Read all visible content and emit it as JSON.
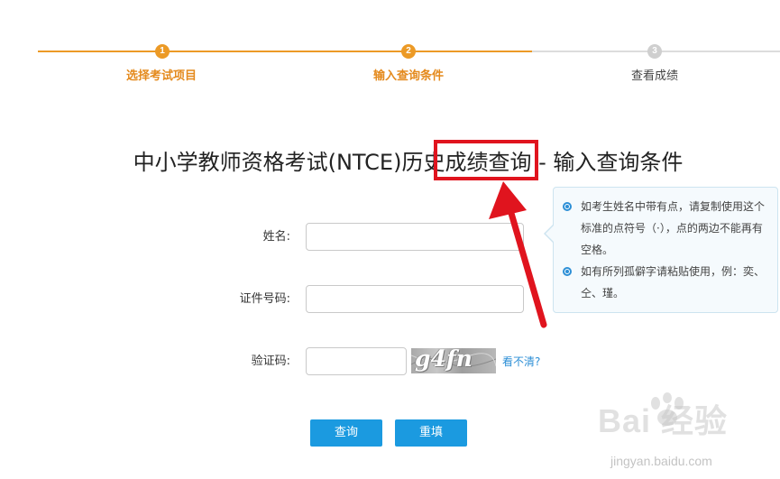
{
  "progress": {
    "steps": [
      {
        "number": "1",
        "label": "选择考试项目",
        "state": "done"
      },
      {
        "number": "2",
        "label": "输入查询条件",
        "state": "current"
      },
      {
        "number": "3",
        "label": "查看成绩",
        "state": "pending"
      }
    ]
  },
  "title": "中小学教师资格考试(NTCE)历史成绩查询 - 输入查询条件",
  "form": {
    "name_label": "姓名:",
    "name_value": "",
    "id_label": "证件号码:",
    "id_value": "",
    "captcha_label": "验证码:",
    "captcha_value": "",
    "captcha_image_text": "g4fn",
    "refresh_text": "看不清?",
    "submit_label": "查询",
    "reset_label": "重填"
  },
  "tip": {
    "items": [
      "如考生姓名中带有点，请复制使用这个标准的点符号（·），点的两边不能再有空格。",
      "如有所列孤僻字请粘贴使用，例：奕、仝、瑾。"
    ]
  },
  "watermark": {
    "logo": "Bai 经验",
    "url": "jingyan.baidu.com"
  },
  "colors": {
    "accent_orange": "#ec9a26",
    "button_blue": "#1b9ae0",
    "link_blue": "#2d8fd6",
    "annotation_red": "#e0141e"
  }
}
